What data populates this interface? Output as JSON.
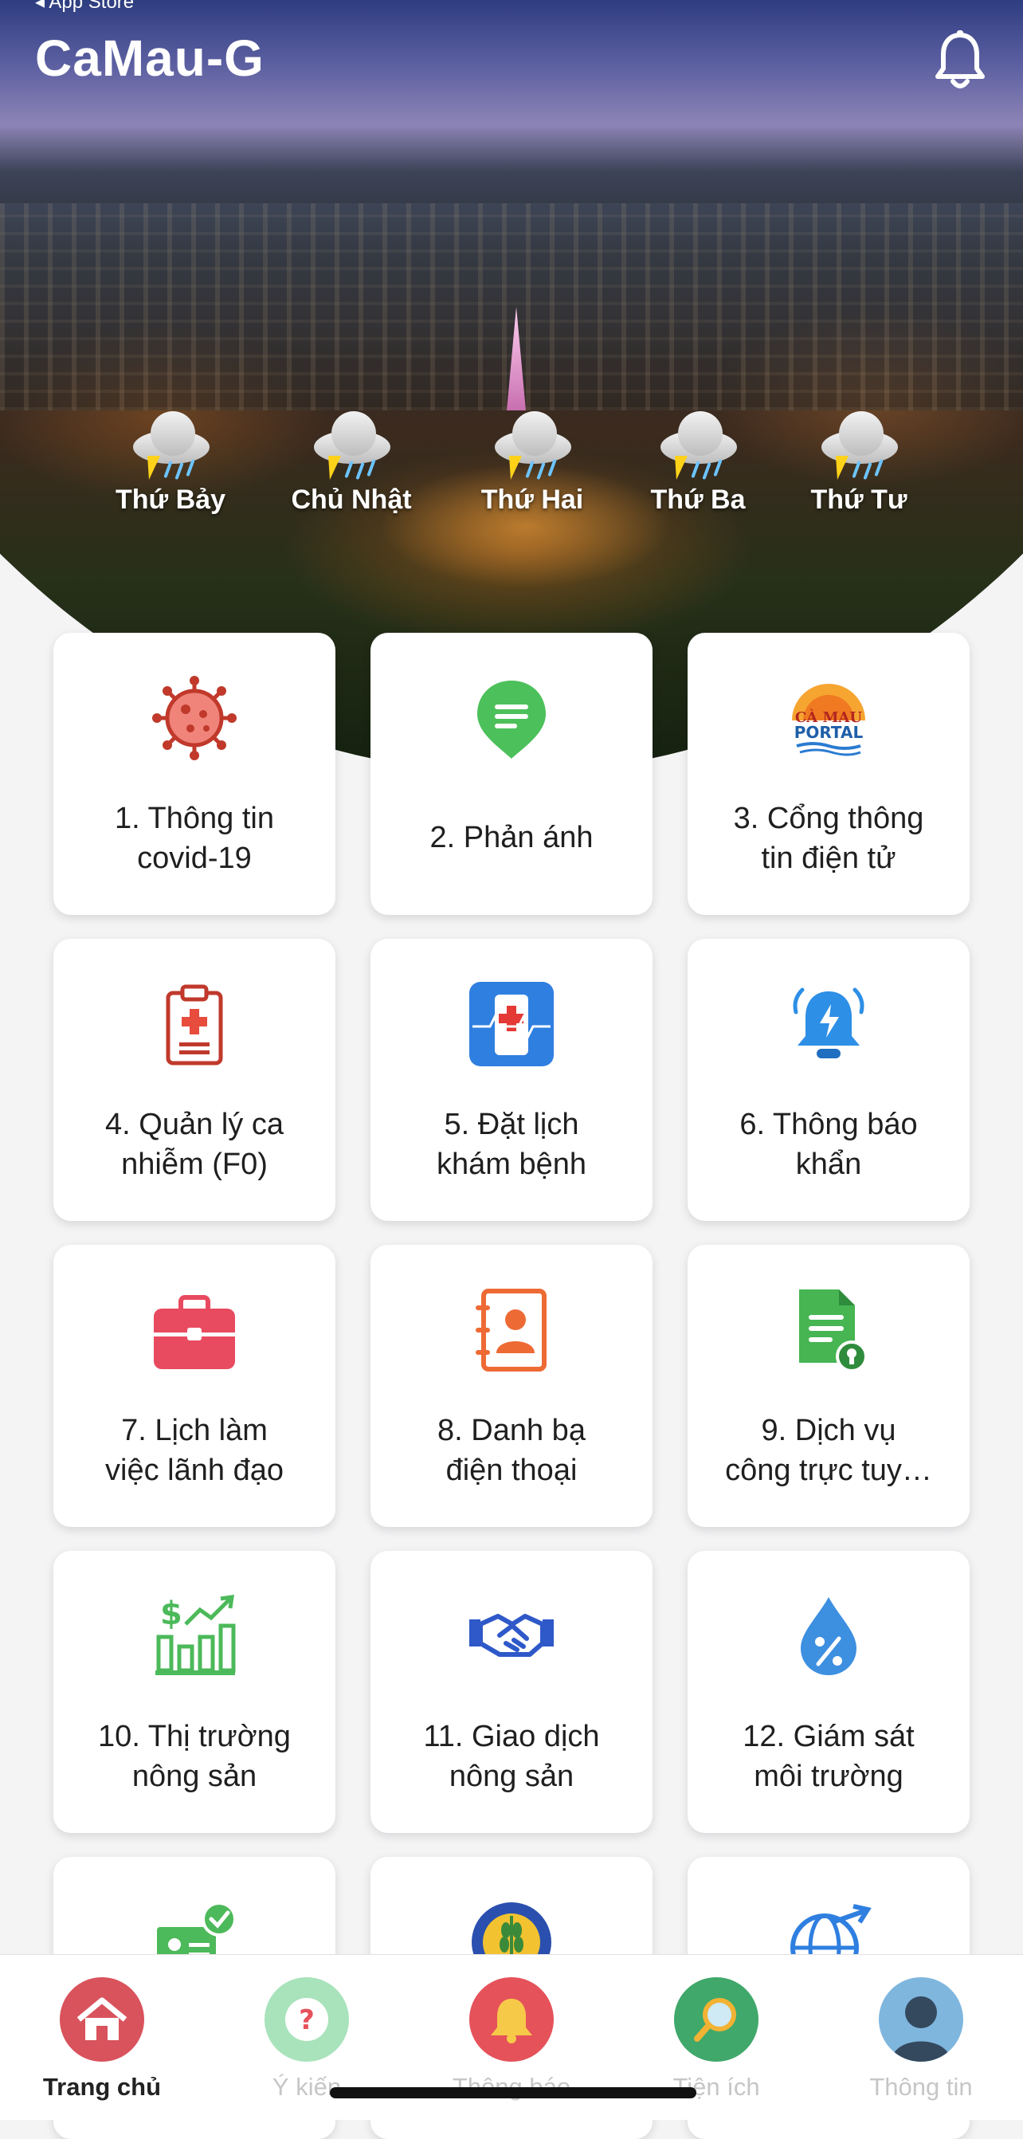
{
  "status_bar": {
    "back_label": "◂ App Store"
  },
  "header": {
    "title": "CaMau-G",
    "bell_icon": "bell-icon"
  },
  "weather": [
    {
      "day": "Thứ Bảy",
      "icon": "thunderstorm-cloud-icon"
    },
    {
      "day": "Chủ Nhật",
      "icon": "thunderstorm-cloud-icon"
    },
    {
      "day": "Thứ Hai",
      "icon": "thunderstorm-cloud-icon"
    },
    {
      "day": "Thứ Ba",
      "icon": "thunderstorm-cloud-icon"
    },
    {
      "day": "Thứ Tư",
      "icon": "thunderstorm-cloud-icon"
    }
  ],
  "tiles": [
    {
      "line1": "1. Thông tin",
      "line2": "covid-19",
      "icon": "virus-icon",
      "color": "#e0544a"
    },
    {
      "line1": "2. Phản ánh",
      "line2": "",
      "icon": "feedback-pin-icon",
      "color": "#4cc05a"
    },
    {
      "line1": "3. Cổng thông",
      "line2": "tin điện tử",
      "icon": "camau-portal-logo",
      "color": "#f28a24"
    },
    {
      "line1": "4. Quản lý ca",
      "line2": "nhiễm (F0)",
      "icon": "medical-clipboard-icon",
      "color": "#d23a3a"
    },
    {
      "line1": "5. Đặt lịch",
      "line2": "khám bệnh",
      "icon": "phone-medical-icon",
      "color": "#2f7fe0"
    },
    {
      "line1": "6. Thông báo",
      "line2": "khẩn",
      "icon": "alarm-bell-icon",
      "color": "#2d8fe6"
    },
    {
      "line1": "7. Lịch làm",
      "line2": "việc lãnh đạo",
      "icon": "briefcase-icon",
      "color": "#e84a5f"
    },
    {
      "line1": "8. Danh bạ",
      "line2": "điện thoại",
      "icon": "contact-book-icon",
      "color": "#ee6a35"
    },
    {
      "line1": "9. Dịch vụ",
      "line2": "công trực tuy…",
      "icon": "document-check-icon",
      "color": "#46b552"
    },
    {
      "line1": "10. Thị trường",
      "line2": "nông sản",
      "icon": "market-chart-icon",
      "color": "#4cb95a"
    },
    {
      "line1": "11. Giao dịch",
      "line2": "nông sản",
      "icon": "handshake-icon",
      "color": "#2f59c9"
    },
    {
      "line1": "12. Giám sát",
      "line2": "môi trường",
      "icon": "water-drop-percent-icon",
      "color": "#3d8fe0"
    },
    {
      "line1": "",
      "line2": "",
      "icon": "certificate-check-icon",
      "color": "#4cb95a"
    },
    {
      "line1": "",
      "line2": "",
      "icon": "agriculture-emblem-icon",
      "color": "#2a4fae"
    },
    {
      "line1": "",
      "line2": "",
      "icon": "globe-arrow-icon",
      "color": "#2f7fe0"
    }
  ],
  "bottom_nav": [
    {
      "label": "Trang chủ",
      "icon": "home-icon",
      "bg": "#d9535c",
      "active": true
    },
    {
      "label": "Ý kiến",
      "icon": "question-icon",
      "bg": "#a8e3bb",
      "active": false
    },
    {
      "label": "Thông báo",
      "icon": "bell-icon",
      "bg": "#e5525a",
      "active": false
    },
    {
      "label": "Tiện ích",
      "icon": "search-icon",
      "bg": "#3fa86a",
      "active": false
    },
    {
      "label": "Thông tin",
      "icon": "user-avatar-icon",
      "bg": "#7fb6de",
      "active": false
    }
  ]
}
